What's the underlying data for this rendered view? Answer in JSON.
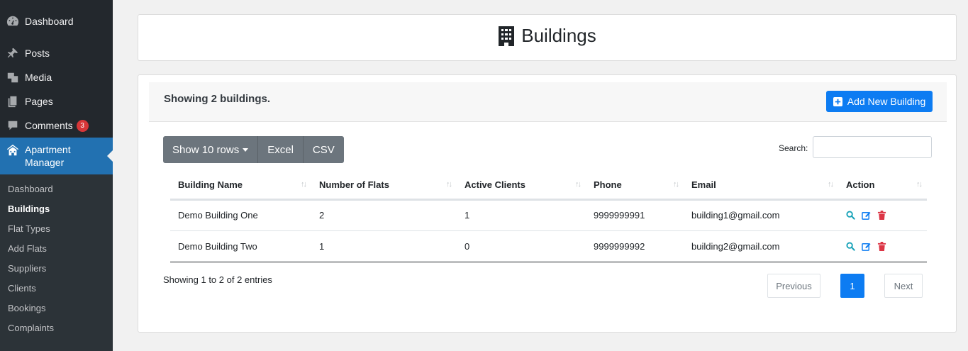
{
  "sidebar": {
    "items": [
      {
        "label": "Dashboard",
        "icon": "dashboard-icon"
      },
      {
        "label": "Posts",
        "icon": "pin-icon"
      },
      {
        "label": "Media",
        "icon": "media-icon"
      },
      {
        "label": "Pages",
        "icon": "pages-icon"
      },
      {
        "label": "Comments",
        "icon": "comment-icon",
        "badge": "3"
      }
    ],
    "active": {
      "label": "Apartment Manager",
      "icon": "building-group-icon"
    },
    "submenu": [
      "Dashboard",
      "Buildings",
      "Flat Types",
      "Add Flats",
      "Suppliers",
      "Clients",
      "Bookings",
      "Complaints"
    ],
    "current_submenu": "Buildings"
  },
  "header": {
    "title": "Buildings",
    "icon": "building-icon"
  },
  "main": {
    "showing_count": "Showing 2 buildings.",
    "add_button": "Add New Building",
    "buttons": {
      "rows": "Show 10 rows",
      "excel": "Excel",
      "csv": "CSV"
    },
    "search_label": "Search:",
    "search_value": "",
    "columns": [
      "Building Name",
      "Number of Flats",
      "Active Clients",
      "Phone",
      "Email",
      "Action"
    ],
    "rows": [
      {
        "name": "Demo Building One",
        "flats": "2",
        "clients": "1",
        "phone": "9999999991",
        "email": "building1@gmail.com"
      },
      {
        "name": "Demo Building Two",
        "flats": "1",
        "clients": "0",
        "phone": "9999999992",
        "email": "building2@gmail.com"
      }
    ],
    "entries_info": "Showing 1 to 2 of 2 entries",
    "pagination": {
      "previous": "Previous",
      "current": "1",
      "next": "Next"
    }
  },
  "colors": {
    "sidebar": "#23282d",
    "sidebar_active": "#2271b1",
    "primary": "#0d7cf2",
    "secondary": "#6c757d",
    "danger": "#dc3545",
    "info": "#17a2b8"
  }
}
